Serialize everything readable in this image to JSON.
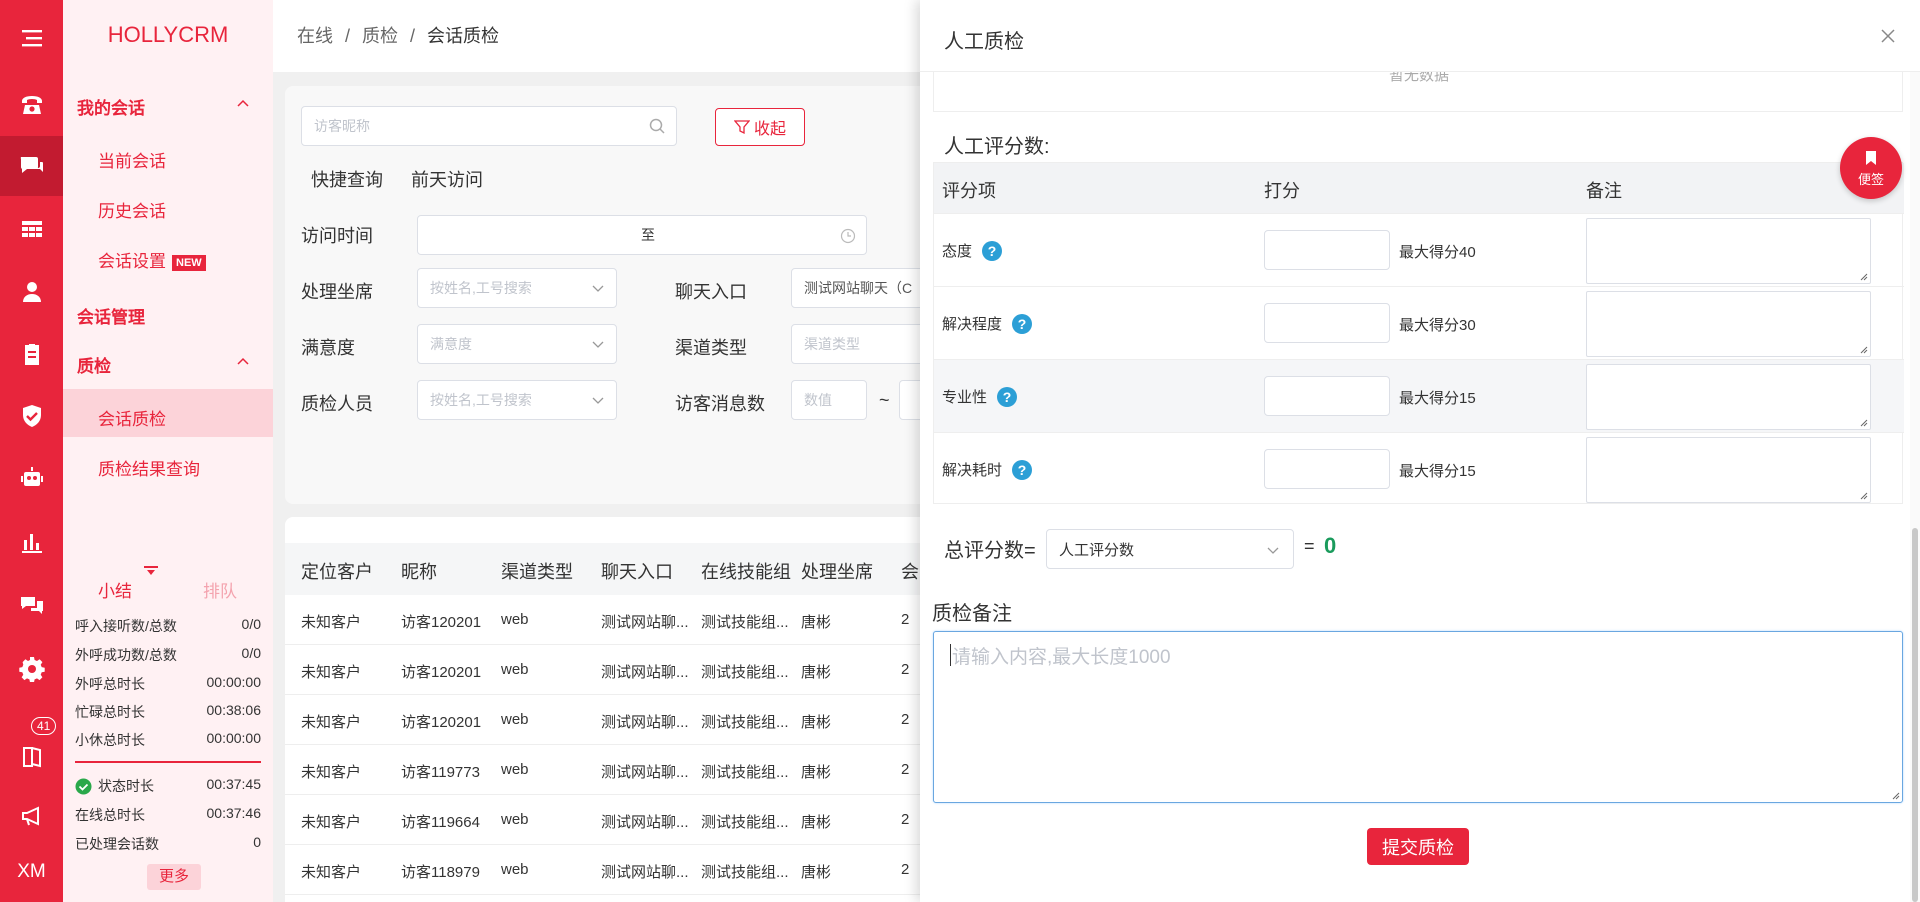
{
  "brand": "HOLLYCRM",
  "rail": {
    "badge_count": "41",
    "user_initials": "XM"
  },
  "sidebar": {
    "groups": {
      "my_sessions": "我的会话",
      "session_mgmt": "会话管理",
      "qc": "质检"
    },
    "links": {
      "current": "当前会话",
      "history": "历史会话",
      "settings": "会话设置",
      "settings_badge": "NEW",
      "session_qc": "会话质检",
      "qc_result": "质检结果查询"
    },
    "summary": {
      "tab_summary": "小结",
      "tab_queue": "排队",
      "rows": [
        {
          "label": "呼入接听数/总数",
          "value": "0/0"
        },
        {
          "label": "外呼成功数/总数",
          "value": "0/0"
        },
        {
          "label": "外呼总时长",
          "value": "00:00:00"
        },
        {
          "label": "忙碌总时长",
          "value": "00:38:06"
        },
        {
          "label": "小休总时长",
          "value": "00:00:00"
        }
      ],
      "rows2": [
        {
          "label": "状态时长",
          "value": "00:37:45"
        },
        {
          "label": "在线总时长",
          "value": "00:37:46"
        },
        {
          "label": "已处理会话数",
          "value": "0"
        }
      ],
      "more": "更多"
    }
  },
  "breadcrumb": {
    "a": "在线",
    "b": "质检",
    "c": "会话质检",
    "sep": "/"
  },
  "filters": {
    "search_placeholder": "访客昵称",
    "collapse": "收起",
    "quick_query": "快捷查询",
    "quick_yesterday": "前天访问",
    "visit_time": "访问时间",
    "to": "至",
    "agent": "处理坐席",
    "agent_ph": "按姓名,工号搜索",
    "entry": "聊天入口",
    "entry_val": "测试网站聊天（C",
    "satisfaction": "满意度",
    "satisfaction_ph": "满意度",
    "channel": "渠道类型",
    "channel_ph": "渠道类型",
    "qc_person": "质检人员",
    "qc_person_ph": "按姓名,工号搜索",
    "msg_count": "访客消息数",
    "msg_ph": "数值",
    "tilde": "~"
  },
  "table": {
    "headers": [
      "定位客户",
      "昵称",
      "渠道类型",
      "聊天入口",
      "在线技能组",
      "处理坐席",
      "会"
    ],
    "rows": [
      [
        "未知客户",
        "访客120201",
        "web",
        "测试网站聊...",
        "测试技能组...",
        "唐彬",
        "2"
      ],
      [
        "未知客户",
        "访客120201",
        "web",
        "测试网站聊...",
        "测试技能组...",
        "唐彬",
        "2"
      ],
      [
        "未知客户",
        "访客120201",
        "web",
        "测试网站聊...",
        "测试技能组...",
        "唐彬",
        "2"
      ],
      [
        "未知客户",
        "访客119773",
        "web",
        "测试网站聊...",
        "测试技能组...",
        "唐彬",
        "2"
      ],
      [
        "未知客户",
        "访客119664",
        "web",
        "测试网站聊...",
        "测试技能组...",
        "唐彬",
        "2"
      ],
      [
        "未知客户",
        "访客118979",
        "web",
        "测试网站聊...",
        "测试技能组...",
        "唐彬",
        "2"
      ]
    ]
  },
  "panel": {
    "title": "人工质检",
    "nodata": "暂无数据",
    "manual_score_title": "人工评分数:",
    "headers": {
      "item": "评分项",
      "score": "打分",
      "note": "备注"
    },
    "items": [
      {
        "name": "态度",
        "max": "最大得分40"
      },
      {
        "name": "解决程度",
        "max": "最大得分30"
      },
      {
        "name": "专业性",
        "max": "最大得分15"
      },
      {
        "name": "解决耗时",
        "max": "最大得分15"
      }
    ],
    "total_label": "总评分数=",
    "total_select": "人工评分数",
    "total_eq": "=",
    "total_value": "0",
    "remark_title": "质检备注",
    "remark_placeholder": "请输入内容,最大长度1000",
    "submit": "提交质检",
    "sticky_note": "便签"
  },
  "colors": {
    "accent": "#e8253c",
    "active_bg": "#fcd3d9",
    "help": "#2c9fd6",
    "total": "#1a9b5c"
  }
}
